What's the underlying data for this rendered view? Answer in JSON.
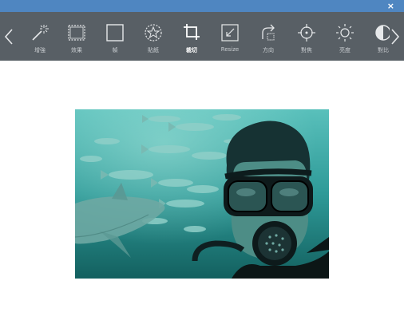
{
  "window": {
    "close_glyph": "×"
  },
  "toolbar": {
    "tools": [
      {
        "label": "增強",
        "icon": "magic-wand-icon"
      },
      {
        "label": "效果",
        "icon": "effects-frame-icon"
      },
      {
        "label": "幀",
        "icon": "frame-icon"
      },
      {
        "label": "貼紙",
        "icon": "sticker-icon"
      },
      {
        "label": "裁切",
        "icon": "crop-icon",
        "active": true
      },
      {
        "label": "Resize",
        "icon": "resize-icon"
      },
      {
        "label": "方向",
        "icon": "rotate-icon"
      },
      {
        "label": "對焦",
        "icon": "focus-icon"
      },
      {
        "label": "亮度",
        "icon": "brightness-icon"
      },
      {
        "label": "對比",
        "icon": "contrast-icon"
      }
    ]
  },
  "photo": {
    "alt": "underwater diver selfie with fish and shark"
  },
  "colors": {
    "topbar": "#4f86c1",
    "toolbar": "#585f65",
    "water": "#2c8f90"
  }
}
